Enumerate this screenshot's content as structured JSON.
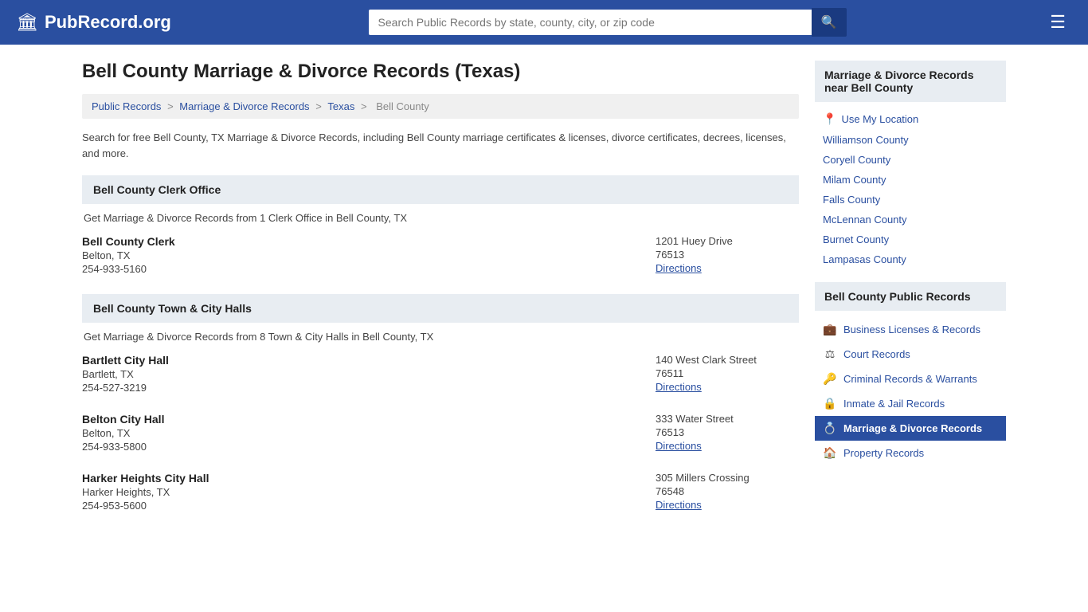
{
  "header": {
    "logo_icon": "🏛",
    "logo_text": "PubRecord.org",
    "search_placeholder": "Search Public Records by state, county, city, or zip code",
    "search_icon": "🔍",
    "menu_icon": "☰"
  },
  "page": {
    "title": "Bell County Marriage & Divorce Records (Texas)",
    "breadcrumb": {
      "items": [
        "Public Records",
        "Marriage & Divorce Records",
        "Texas",
        "Bell County"
      ]
    },
    "description": "Search for free Bell County, TX Marriage & Divorce Records, including Bell County marriage certificates & licenses, divorce certificates, decrees, licenses, and more."
  },
  "clerk_section": {
    "header": "Bell County Clerk Office",
    "description": "Get Marriage & Divorce Records from 1 Clerk Office in Bell County, TX",
    "entries": [
      {
        "name": "Bell County Clerk",
        "city": "Belton, TX",
        "phone": "254-933-5160",
        "address": "1201 Huey Drive",
        "zip": "76513",
        "directions_label": "Directions"
      }
    ]
  },
  "town_section": {
    "header": "Bell County Town & City Halls",
    "description": "Get Marriage & Divorce Records from 8 Town & City Halls in Bell County, TX",
    "entries": [
      {
        "name": "Bartlett City Hall",
        "city": "Bartlett, TX",
        "phone": "254-527-3219",
        "address": "140 West Clark Street",
        "zip": "76511",
        "directions_label": "Directions"
      },
      {
        "name": "Belton City Hall",
        "city": "Belton, TX",
        "phone": "254-933-5800",
        "address": "333 Water Street",
        "zip": "76513",
        "directions_label": "Directions"
      },
      {
        "name": "Harker Heights City Hall",
        "city": "Harker Heights, TX",
        "phone": "254-953-5600",
        "address": "305 Millers Crossing",
        "zip": "76548",
        "directions_label": "Directions"
      }
    ]
  },
  "sidebar": {
    "nearby_title": "Marriage & Divorce Records near Bell County",
    "use_location_label": "Use My Location",
    "nearby_counties": [
      "Williamson County",
      "Coryell County",
      "Milam County",
      "Falls County",
      "McLennan County",
      "Burnet County",
      "Lampasas County"
    ],
    "public_records_title": "Bell County Public Records",
    "public_records_items": [
      {
        "icon": "💼",
        "label": "Business Licenses & Records",
        "active": false
      },
      {
        "icon": "⚖",
        "label": "Court Records",
        "active": false
      },
      {
        "icon": "🔑",
        "label": "Criminal Records & Warrants",
        "active": false
      },
      {
        "icon": "🔒",
        "label": "Inmate & Jail Records",
        "active": false
      },
      {
        "icon": "💍",
        "label": "Marriage & Divorce Records",
        "active": true
      },
      {
        "icon": "🏠",
        "label": "Property Records",
        "active": false
      }
    ]
  }
}
